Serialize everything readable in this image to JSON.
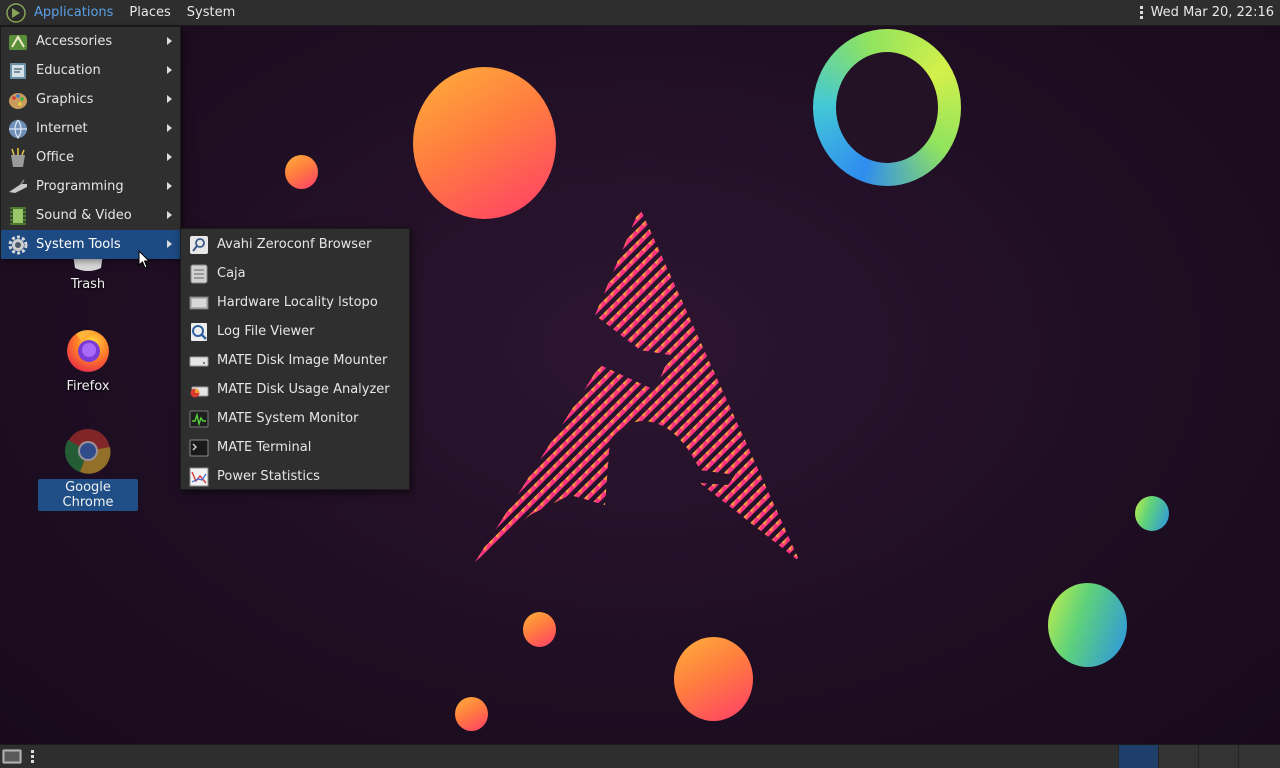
{
  "top_panel": {
    "menus": [
      {
        "label": "Applications",
        "active": true
      },
      {
        "label": "Places"
      },
      {
        "label": "System"
      }
    ],
    "clock": "Wed Mar 20, 22:16"
  },
  "applications_menu": {
    "items": [
      {
        "label": "Accessories",
        "icon": "accessories-icon"
      },
      {
        "label": "Education",
        "icon": "education-icon"
      },
      {
        "label": "Graphics",
        "icon": "graphics-icon"
      },
      {
        "label": "Internet",
        "icon": "internet-globe-icon"
      },
      {
        "label": "Office",
        "icon": "office-icon"
      },
      {
        "label": "Programming",
        "icon": "programming-icon"
      },
      {
        "label": "Sound & Video",
        "icon": "sound-video-icon"
      },
      {
        "label": "System Tools",
        "icon": "gear-icon",
        "highlighted": true
      }
    ]
  },
  "system_tools_submenu": {
    "items": [
      {
        "label": "Avahi Zeroconf Browser",
        "icon": "magnifier-icon"
      },
      {
        "label": "Caja",
        "icon": "file-manager-icon"
      },
      {
        "label": "Hardware Locality lstopo",
        "icon": "hardware-icon"
      },
      {
        "label": "Log File Viewer",
        "icon": "log-viewer-icon"
      },
      {
        "label": "MATE Disk Image Mounter",
        "icon": "disk-icon"
      },
      {
        "label": "MATE Disk Usage Analyzer",
        "icon": "disk-usage-icon"
      },
      {
        "label": "MATE System Monitor",
        "icon": "system-monitor-icon"
      },
      {
        "label": "MATE Terminal",
        "icon": "terminal-icon"
      },
      {
        "label": "Power Statistics",
        "icon": "power-statistics-icon"
      }
    ]
  },
  "desktop_icons": [
    {
      "label": "Trash",
      "icon": "trash-icon"
    },
    {
      "label": "Firefox",
      "icon": "firefox-icon"
    },
    {
      "label": "Google Chrome",
      "icon": "chrome-icon",
      "selected": true
    }
  ],
  "colors": {
    "panel": "#2e2e2e",
    "menu_bg": "#2f2f2f",
    "highlight": "#1d4a82",
    "active_menu_text": "#5aa0e6",
    "background": "#1f0e23"
  }
}
